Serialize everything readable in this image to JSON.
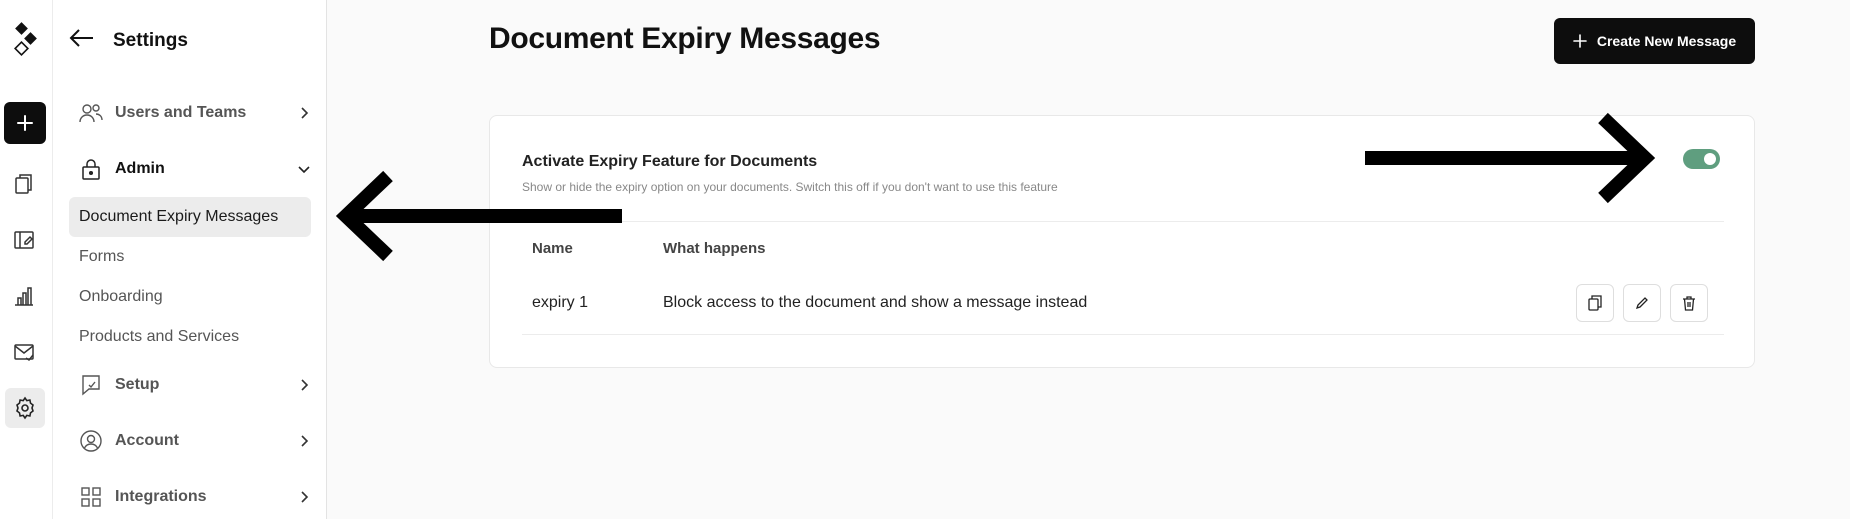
{
  "sidebar": {
    "title": "Settings",
    "items": [
      {
        "label": "Users and Teams"
      },
      {
        "label": "Admin"
      },
      {
        "label": "Setup"
      },
      {
        "label": "Account"
      },
      {
        "label": "Integrations"
      }
    ],
    "admin_subitems": [
      {
        "label": "Document Expiry Messages"
      },
      {
        "label": "Forms"
      },
      {
        "label": "Onboarding"
      },
      {
        "label": "Products and Services"
      }
    ]
  },
  "main": {
    "title": "Document Expiry Messages",
    "create_button_label": "Create New Message",
    "feature": {
      "title": "Activate Expiry Feature for Documents",
      "description": "Show or hide the expiry option on your documents. Switch this off if you don't want to use this feature",
      "enabled": true
    },
    "table": {
      "headers": [
        "Name",
        "What happens"
      ],
      "rows": [
        {
          "name": "expiry 1",
          "what_happens": "Block access to the document and show a message instead"
        }
      ]
    }
  },
  "colors": {
    "accent_dark": "#0d0d0d",
    "toggle_on": "#5f9e7f",
    "active_bg": "#ececec"
  },
  "icons": [
    "logo-icon",
    "plus-icon",
    "documents-icon",
    "templates-icon",
    "reports-icon",
    "mail-icon",
    "gear-icon",
    "back-arrow-icon",
    "users-icon",
    "lock-icon",
    "chevron-right-icon",
    "chevron-down-icon",
    "setup-icon",
    "account-icon",
    "integrations-icon",
    "copy-icon",
    "edit-icon",
    "trash-icon"
  ]
}
